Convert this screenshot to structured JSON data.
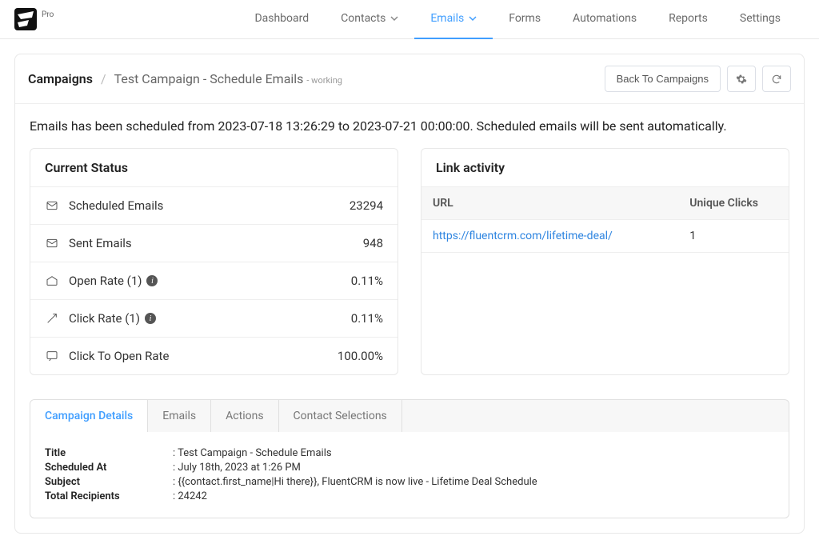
{
  "header": {
    "pro_badge": "Pro",
    "nav": {
      "dashboard": "Dashboard",
      "contacts": "Contacts",
      "emails": "Emails",
      "forms": "Forms",
      "automations": "Automations",
      "reports": "Reports",
      "settings": "Settings"
    }
  },
  "breadcrumb": {
    "root": "Campaigns",
    "current": "Test Campaign - Schedule Emails",
    "status": "- working"
  },
  "actions": {
    "back": "Back To Campaigns"
  },
  "notice": "Emails has been scheduled from 2023-07-18 13:26:29 to 2023-07-21 00:00:00. Scheduled emails will be sent automatically.",
  "status_card": {
    "title": "Current Status",
    "rows": {
      "scheduled": {
        "label": "Scheduled Emails",
        "value": "23294"
      },
      "sent": {
        "label": "Sent Emails",
        "value": "948"
      },
      "open": {
        "label": "Open Rate (1)",
        "value": "0.11%"
      },
      "click": {
        "label": "Click Rate (1)",
        "value": "0.11%"
      },
      "cto": {
        "label": "Click To Open Rate",
        "value": "100.00%"
      }
    }
  },
  "link_card": {
    "title": "Link activity",
    "col_url": "URL",
    "col_clicks": "Unique Clicks",
    "rows": [
      {
        "url": "https://fluentcrm.com/lifetime-deal/",
        "clicks": "1"
      }
    ]
  },
  "tabs": {
    "details": "Campaign Details",
    "emails": "Emails",
    "actions": "Actions",
    "contacts": "Contact Selections"
  },
  "details": {
    "title_k": "Title",
    "title_v": ": Test Campaign - Schedule Emails",
    "sched_k": "Scheduled At",
    "sched_v": ": July 18th, 2023 at 1:26 PM",
    "subj_k": "Subject",
    "subj_v": ": {{contact.first_name|Hi there}}, FluentCRM is now live - Lifetime Deal Schedule",
    "recip_k": "Total Recipients",
    "recip_v": ": 24242"
  }
}
